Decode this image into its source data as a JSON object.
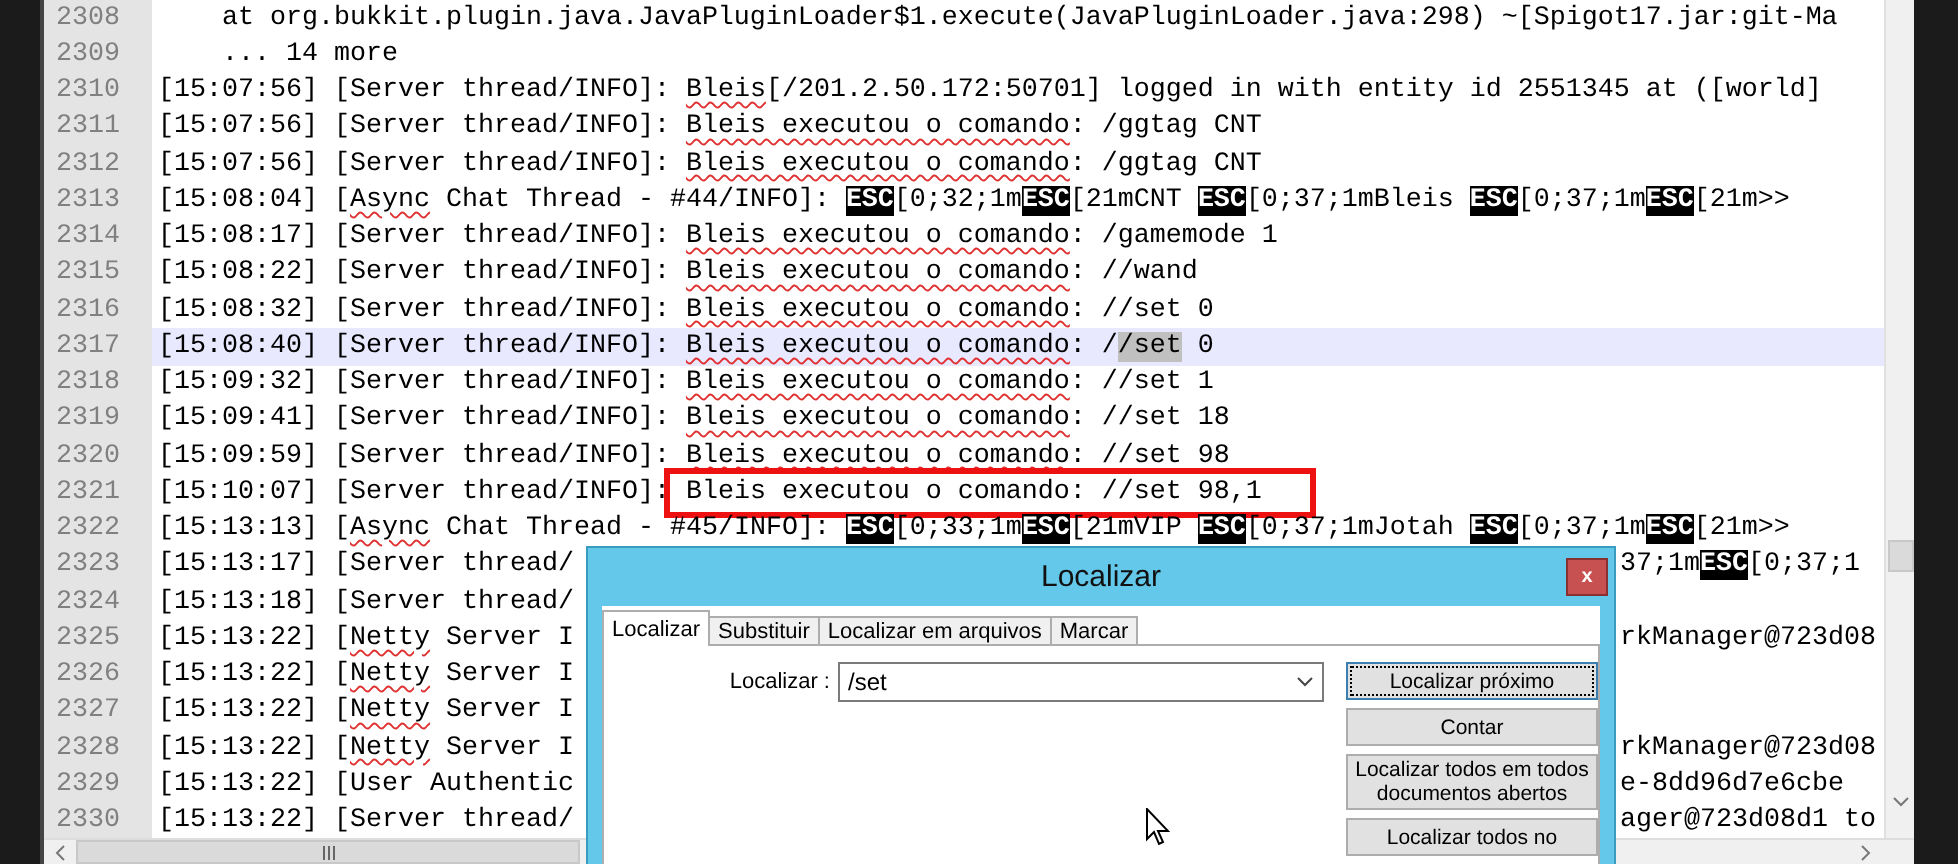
{
  "editor": {
    "lines": [
      {
        "number": "2308",
        "selected": false,
        "segments": [
          {
            "kind": "text",
            "text": "    at org.bukkit.plugin.java.JavaPluginLoader$1.execute(JavaPluginLoader.java:298) ~[Spigot17.jar:git-Ma"
          }
        ]
      },
      {
        "number": "2309",
        "selected": false,
        "segments": [
          {
            "kind": "text",
            "text": "    ... 14 more"
          }
        ]
      },
      {
        "number": "2310",
        "selected": false,
        "segments": [
          {
            "kind": "text",
            "text": "[15:07:56] [Server thread/INFO]: "
          },
          {
            "kind": "spell",
            "text": "Bleis"
          },
          {
            "kind": "text",
            "text": "[/201.2.50.172:50701] logged in with entity id 2551345 at ([world]"
          }
        ]
      },
      {
        "number": "2311",
        "selected": false,
        "segments": [
          {
            "kind": "text",
            "text": "[15:07:56] [Server thread/INFO]: "
          },
          {
            "kind": "spell",
            "text": "Bleis executou o comando"
          },
          {
            "kind": "text",
            "text": ": /ggtag CNT"
          }
        ]
      },
      {
        "number": "2312",
        "selected": false,
        "segments": [
          {
            "kind": "text",
            "text": "[15:07:56] [Server thread/INFO]: "
          },
          {
            "kind": "spell",
            "text": "Bleis executou o comando"
          },
          {
            "kind": "text",
            "text": ": /ggtag CNT"
          }
        ]
      },
      {
        "number": "2313",
        "selected": false,
        "segments": [
          {
            "kind": "text",
            "text": "[15:08:04] ["
          },
          {
            "kind": "spell",
            "text": "Async"
          },
          {
            "kind": "text",
            "text": " Chat Thread - #44/INFO]: "
          },
          {
            "kind": "esc",
            "text": "ESC"
          },
          {
            "kind": "text",
            "text": "[0;32;1m"
          },
          {
            "kind": "esc",
            "text": "ESC"
          },
          {
            "kind": "text",
            "text": "[21mCNT "
          },
          {
            "kind": "esc",
            "text": "ESC"
          },
          {
            "kind": "text",
            "text": "[0;37;1mBleis "
          },
          {
            "kind": "esc",
            "text": "ESC"
          },
          {
            "kind": "text",
            "text": "[0;37;1m"
          },
          {
            "kind": "esc",
            "text": "ESC"
          },
          {
            "kind": "text",
            "text": "[21m>>"
          }
        ]
      },
      {
        "number": "2314",
        "selected": false,
        "segments": [
          {
            "kind": "text",
            "text": "[15:08:17] [Server thread/INFO]: "
          },
          {
            "kind": "spell",
            "text": "Bleis executou o comando"
          },
          {
            "kind": "text",
            "text": ": /gamemode 1"
          }
        ]
      },
      {
        "number": "2315",
        "selected": false,
        "segments": [
          {
            "kind": "text",
            "text": "[15:08:22] [Server thread/INFO]: "
          },
          {
            "kind": "spell",
            "text": "Bleis executou o comando"
          },
          {
            "kind": "text",
            "text": ": //wand"
          }
        ]
      },
      {
        "number": "2316",
        "selected": false,
        "segments": [
          {
            "kind": "text",
            "text": "[15:08:32] [Server thread/INFO]: "
          },
          {
            "kind": "spell",
            "text": "Bleis executou o comando"
          },
          {
            "kind": "text",
            "text": ": //set 0"
          }
        ]
      },
      {
        "number": "2317",
        "selected": true,
        "segments": [
          {
            "kind": "text",
            "text": "[15:08:40] [Server thread/INFO]: "
          },
          {
            "kind": "spell",
            "text": "Bleis executou o comando"
          },
          {
            "kind": "text",
            "text": ": /"
          },
          {
            "kind": "match",
            "text": "/set"
          },
          {
            "kind": "text",
            "text": " 0"
          }
        ]
      },
      {
        "number": "2318",
        "selected": false,
        "segments": [
          {
            "kind": "text",
            "text": "[15:09:32] [Server thread/INFO]: "
          },
          {
            "kind": "spell",
            "text": "Bleis executou o comando"
          },
          {
            "kind": "text",
            "text": ": //set 1"
          }
        ]
      },
      {
        "number": "2319",
        "selected": false,
        "segments": [
          {
            "kind": "text",
            "text": "[15:09:41] [Server thread/INFO]: "
          },
          {
            "kind": "spell",
            "text": "Bleis executou o comando"
          },
          {
            "kind": "text",
            "text": ": //set 18"
          }
        ]
      },
      {
        "number": "2320",
        "selected": false,
        "segments": [
          {
            "kind": "text",
            "text": "[15:09:59] [Server thread/INFO]: "
          },
          {
            "kind": "spell",
            "text": "Bleis executou o comando"
          },
          {
            "kind": "text",
            "text": ": //set 98"
          }
        ]
      },
      {
        "number": "2321",
        "selected": false,
        "segments": [
          {
            "kind": "text",
            "text": "[15:10:07] [Server thread/INFO]: "
          },
          {
            "kind": "boxed",
            "text": "Bleis executou o comando: //set 98,1"
          }
        ]
      },
      {
        "number": "2322",
        "selected": false,
        "segments": [
          {
            "kind": "text",
            "text": "[15:13:13] ["
          },
          {
            "kind": "spell",
            "text": "Async"
          },
          {
            "kind": "text",
            "text": " Chat Thread - #45/INFO]: "
          },
          {
            "kind": "esc",
            "text": "ESC"
          },
          {
            "kind": "text",
            "text": "[0;33;1m"
          },
          {
            "kind": "esc",
            "text": "ESC"
          },
          {
            "kind": "text",
            "text": "[21mVIP "
          },
          {
            "kind": "esc",
            "text": "ESC"
          },
          {
            "kind": "text",
            "text": "[0;37;1mJotah "
          },
          {
            "kind": "esc",
            "text": "ESC"
          },
          {
            "kind": "text",
            "text": "[0;37;1m"
          },
          {
            "kind": "esc",
            "text": "ESC"
          },
          {
            "kind": "text",
            "text": "[21m>>"
          }
        ]
      },
      {
        "number": "2323",
        "selected": false,
        "segments": [
          {
            "kind": "text",
            "text": "[15:13:17] [Server thread/"
          }
        ],
        "tail": [
          {
            "kind": "text",
            "text": "37;1m"
          },
          {
            "kind": "esc",
            "text": "ESC"
          },
          {
            "kind": "text",
            "text": "[0;37;1"
          }
        ]
      },
      {
        "number": "2324",
        "selected": false,
        "segments": [
          {
            "kind": "text",
            "text": "[15:13:18] [Server thread/"
          }
        ]
      },
      {
        "number": "2325",
        "selected": false,
        "segments": [
          {
            "kind": "text",
            "text": "[15:13:22] ["
          },
          {
            "kind": "spell",
            "text": "Netty"
          },
          {
            "kind": "text",
            "text": " Server I"
          }
        ],
        "tail": [
          {
            "kind": "text",
            "text": "rkManager@723d08"
          }
        ]
      },
      {
        "number": "2326",
        "selected": false,
        "segments": [
          {
            "kind": "text",
            "text": "[15:13:22] ["
          },
          {
            "kind": "spell",
            "text": "Netty"
          },
          {
            "kind": "text",
            "text": " Server I"
          }
        ]
      },
      {
        "number": "2327",
        "selected": false,
        "segments": [
          {
            "kind": "text",
            "text": "[15:13:22] ["
          },
          {
            "kind": "spell",
            "text": "Netty"
          },
          {
            "kind": "text",
            "text": " Server I"
          }
        ]
      },
      {
        "number": "2328",
        "selected": false,
        "segments": [
          {
            "kind": "text",
            "text": "[15:13:22] ["
          },
          {
            "kind": "spell",
            "text": "Netty"
          },
          {
            "kind": "text",
            "text": " Server I"
          }
        ],
        "tail": [
          {
            "kind": "text",
            "text": "rkManager@723d08"
          }
        ]
      },
      {
        "number": "2329",
        "selected": false,
        "segments": [
          {
            "kind": "text",
            "text": "[15:13:22] [User Authentic"
          }
        ],
        "tail": [
          {
            "kind": "text",
            "text": "e-8dd96d7e6cbe"
          }
        ]
      },
      {
        "number": "2330",
        "selected": false,
        "segments": [
          {
            "kind": "text",
            "text": "[15:13:22] [Server thread/"
          }
        ],
        "tail": [
          {
            "kind": "text",
            "text": "ager@723d08d1 to"
          }
        ]
      }
    ]
  },
  "dialog": {
    "title": "Localizar",
    "close": "x",
    "tabs": [
      {
        "label": "Localizar",
        "selected": true
      },
      {
        "label": "Substituir",
        "selected": false
      },
      {
        "label": "Localizar em arquivos",
        "selected": false
      },
      {
        "label": "Marcar",
        "selected": false
      }
    ],
    "search": {
      "label": "Localizar :",
      "value": "/set"
    },
    "buttons": [
      {
        "label": "Localizar próximo",
        "focused": true
      },
      {
        "label": "Contar",
        "focused": false
      },
      {
        "label": "Localizar todos em todos documentos abertos",
        "focused": false
      },
      {
        "label": "Localizar todos no",
        "focused": false
      }
    ]
  }
}
